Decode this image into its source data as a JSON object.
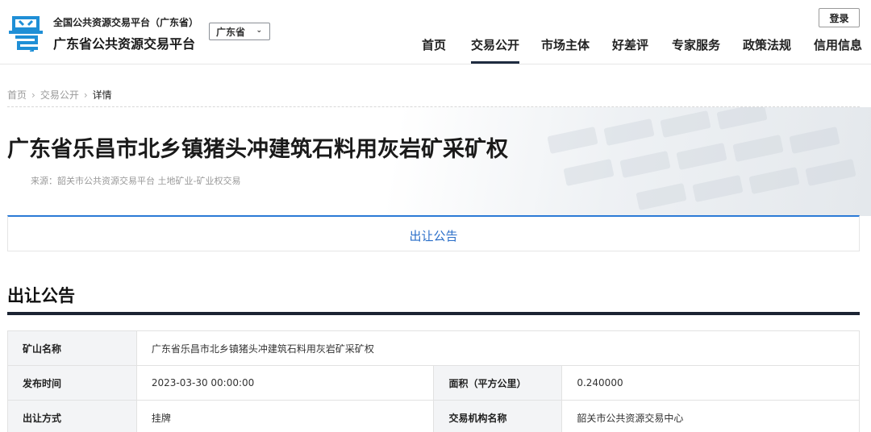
{
  "header": {
    "logo_icon": "粤-logo-icon",
    "brand_sub": "全国公共资源交易平台（广东省）",
    "brand_main": "广东省公共资源交易平台",
    "region": "广东省",
    "login_label": "登录",
    "nav": [
      {
        "label": "首页"
      },
      {
        "label": "交易公开",
        "active": true
      },
      {
        "label": "市场主体"
      },
      {
        "label": "好差评"
      },
      {
        "label": "专家服务"
      },
      {
        "label": "政策法规"
      },
      {
        "label": "信用信息"
      }
    ]
  },
  "breadcrumb": [
    "首页",
    "交易公开",
    "详情"
  ],
  "hero": {
    "title": "广东省乐昌市北乡镇猪头冲建筑石料用灰岩矿采矿权",
    "source": "来源：韶关市公共资源交易平台  土地矿业-矿业权交易"
  },
  "tab": {
    "label": "出让公告"
  },
  "section": {
    "title": "出让公告"
  },
  "table": {
    "rows": [
      [
        {
          "label": "矿山名称",
          "value": "广东省乐昌市北乡镇猪头冲建筑石料用灰岩矿采矿权"
        }
      ],
      [
        {
          "label": "发布时间",
          "value": "2023-03-30 00:00:00"
        },
        {
          "label": "面积（平方公里）",
          "value": "0.240000"
        }
      ],
      [
        {
          "label": "出让方式",
          "value": "挂牌"
        },
        {
          "label": "交易机构名称",
          "value": "韶关市公共资源交易中心"
        }
      ]
    ]
  },
  "colors": {
    "accent_blue": "#2b7ad6",
    "nav_active": "#1f2c40",
    "section_rule": "#1c2433"
  }
}
